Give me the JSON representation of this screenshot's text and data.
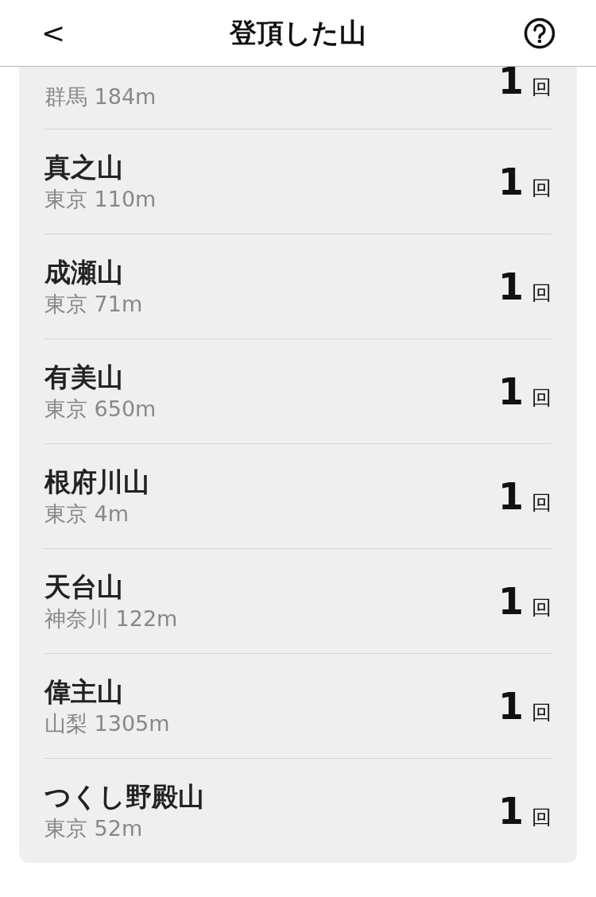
{
  "header": {
    "back": "<",
    "title": "登頂した山"
  },
  "mountains": [
    {
      "kind": "partial",
      "detail": "群馬 184m",
      "count": "1",
      "unit": "回"
    },
    {
      "kind": "full",
      "name": "真之山",
      "detail": "東京 110m",
      "count": "1",
      "unit": "回"
    },
    {
      "kind": "full",
      "name": "成瀬山",
      "detail": "東京 71m",
      "count": "1",
      "unit": "回"
    },
    {
      "kind": "full",
      "name": "有美山",
      "detail": "東京 650m",
      "count": "1",
      "unit": "回"
    },
    {
      "kind": "full",
      "name": "根府川山",
      "detail": "東京 4m",
      "count": "1",
      "unit": "回"
    },
    {
      "kind": "full",
      "name": "天台山",
      "detail": "神奈川 122m",
      "count": "1",
      "unit": "回"
    },
    {
      "kind": "full",
      "name": "偉主山",
      "detail": "山梨 1305m",
      "count": "1",
      "unit": "回"
    },
    {
      "kind": "full",
      "name": "つくし野殿山",
      "detail": "東京 52m",
      "count": "1",
      "unit": "回"
    }
  ]
}
